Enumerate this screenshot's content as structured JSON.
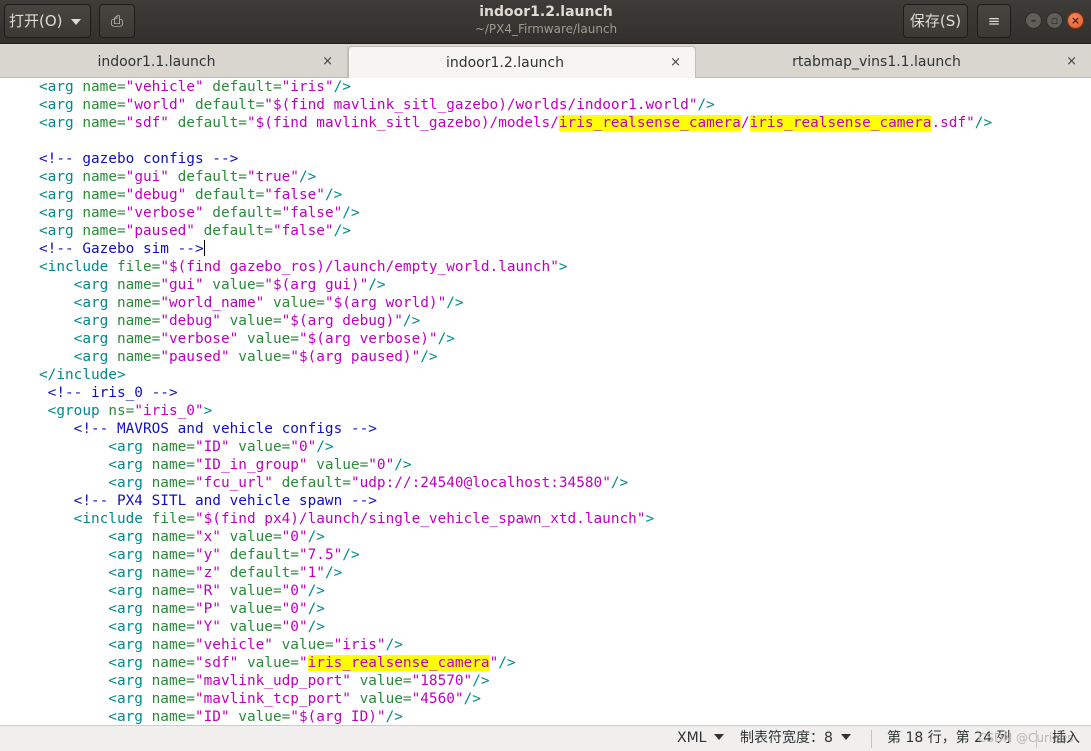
{
  "header": {
    "open_label": "打开(O)",
    "title": "indoor1.2.launch",
    "subtitle": "~/PX4_Firmware/launch",
    "save_label": "保存(S)",
    "menu_glyph": "≡",
    "newtab_glyph": "⎙",
    "min_glyph": "–",
    "max_glyph": "▫",
    "close_glyph": "×"
  },
  "tabs": [
    {
      "label": "indoor1.1.launch",
      "close": "×"
    },
    {
      "label": "indoor1.2.launch",
      "close": "×"
    },
    {
      "label": "rtabmap_vins1.1.launch",
      "close": "×"
    }
  ],
  "editor": {
    "cursor_line": 18,
    "lines": [
      [
        [
          "t",
          "<arg "
        ],
        [
          "a",
          "name="
        ],
        [
          "v",
          "\"vehicle\""
        ],
        [
          "a",
          " default="
        ],
        [
          "v",
          "\"iris\""
        ],
        [
          "t",
          "/>"
        ]
      ],
      [
        [
          "t",
          "<arg "
        ],
        [
          "a",
          "name="
        ],
        [
          "v",
          "\"world\""
        ],
        [
          "a",
          " default="
        ],
        [
          "v",
          "\"$(find mavlink_sitl_gazebo)/worlds/indoor1.world\""
        ],
        [
          "t",
          "/>"
        ]
      ],
      [
        [
          "t",
          "<arg "
        ],
        [
          "a",
          "name="
        ],
        [
          "v",
          "\"sdf\""
        ],
        [
          "a",
          " default="
        ],
        [
          "v",
          "\"$(find mavlink_sitl_gazebo)/models/"
        ],
        [
          "vh",
          "iris_realsense_camera"
        ],
        [
          "v",
          "/"
        ],
        [
          "vh",
          "iris_realsense_camera"
        ],
        [
          "v",
          ".sdf\""
        ],
        [
          "t",
          "/>"
        ]
      ],
      [],
      [
        [
          "c",
          "<!-- gazebo configs -->"
        ]
      ],
      [
        [
          "t",
          "<arg "
        ],
        [
          "a",
          "name="
        ],
        [
          "v",
          "\"gui\""
        ],
        [
          "a",
          " default="
        ],
        [
          "v",
          "\"true\""
        ],
        [
          "t",
          "/>"
        ]
      ],
      [
        [
          "t",
          "<arg "
        ],
        [
          "a",
          "name="
        ],
        [
          "v",
          "\"debug\""
        ],
        [
          "a",
          " default="
        ],
        [
          "v",
          "\"false\""
        ],
        [
          "t",
          "/>"
        ]
      ],
      [
        [
          "t",
          "<arg "
        ],
        [
          "a",
          "name="
        ],
        [
          "v",
          "\"verbose\""
        ],
        [
          "a",
          " default="
        ],
        [
          "v",
          "\"false\""
        ],
        [
          "t",
          "/>"
        ]
      ],
      [
        [
          "t",
          "<arg "
        ],
        [
          "a",
          "name="
        ],
        [
          "v",
          "\"paused\""
        ],
        [
          "a",
          " default="
        ],
        [
          "v",
          "\"false\""
        ],
        [
          "t",
          "/>"
        ]
      ],
      [
        [
          "c",
          "<!-- Gazebo sim -->"
        ],
        [
          "cursor",
          ""
        ]
      ],
      [
        [
          "t",
          "<include "
        ],
        [
          "a",
          "file="
        ],
        [
          "v",
          "\"$(find gazebo_ros)/launch/empty_world.launch\""
        ],
        [
          "t",
          ">"
        ]
      ],
      [
        [
          "t",
          "    <arg "
        ],
        [
          "a",
          "name="
        ],
        [
          "v",
          "\"gui\""
        ],
        [
          "a",
          " value="
        ],
        [
          "v",
          "\"$(arg gui)\""
        ],
        [
          "t",
          "/>"
        ]
      ],
      [
        [
          "t",
          "    <arg "
        ],
        [
          "a",
          "name="
        ],
        [
          "v",
          "\"world_name\""
        ],
        [
          "a",
          " value="
        ],
        [
          "v",
          "\"$(arg world)\""
        ],
        [
          "t",
          "/>"
        ]
      ],
      [
        [
          "t",
          "    <arg "
        ],
        [
          "a",
          "name="
        ],
        [
          "v",
          "\"debug\""
        ],
        [
          "a",
          " value="
        ],
        [
          "v",
          "\"$(arg debug)\""
        ],
        [
          "t",
          "/>"
        ]
      ],
      [
        [
          "t",
          "    <arg "
        ],
        [
          "a",
          "name="
        ],
        [
          "v",
          "\"verbose\""
        ],
        [
          "a",
          " value="
        ],
        [
          "v",
          "\"$(arg verbose)\""
        ],
        [
          "t",
          "/>"
        ]
      ],
      [
        [
          "t",
          "    <arg "
        ],
        [
          "a",
          "name="
        ],
        [
          "v",
          "\"paused\""
        ],
        [
          "a",
          " value="
        ],
        [
          "v",
          "\"$(arg paused)\""
        ],
        [
          "t",
          "/>"
        ]
      ],
      [
        [
          "t",
          "</include>"
        ]
      ],
      [
        [
          "c",
          " <!-- iris_0 -->"
        ]
      ],
      [
        [
          "t",
          " <group "
        ],
        [
          "a",
          "ns="
        ],
        [
          "v",
          "\"iris_0\""
        ],
        [
          "t",
          ">"
        ]
      ],
      [
        [
          "c",
          "    <!-- MAVROS and vehicle configs -->"
        ]
      ],
      [
        [
          "t",
          "        <arg "
        ],
        [
          "a",
          "name="
        ],
        [
          "v",
          "\"ID\""
        ],
        [
          "a",
          " value="
        ],
        [
          "v",
          "\"0\""
        ],
        [
          "t",
          "/>"
        ]
      ],
      [
        [
          "t",
          "        <arg "
        ],
        [
          "a",
          "name="
        ],
        [
          "v",
          "\"ID_in_group\""
        ],
        [
          "a",
          " value="
        ],
        [
          "v",
          "\"0\""
        ],
        [
          "t",
          "/>"
        ]
      ],
      [
        [
          "t",
          "        <arg "
        ],
        [
          "a",
          "name="
        ],
        [
          "v",
          "\"fcu_url\""
        ],
        [
          "a",
          " default="
        ],
        [
          "v",
          "\"udp://:24540@localhost:34580\""
        ],
        [
          "t",
          "/>"
        ]
      ],
      [
        [
          "c",
          "    <!-- PX4 SITL and vehicle spawn -->"
        ]
      ],
      [
        [
          "t",
          "    <include "
        ],
        [
          "a",
          "file="
        ],
        [
          "v",
          "\"$(find px4)/launch/single_vehicle_spawn_xtd.launch\""
        ],
        [
          "t",
          ">"
        ]
      ],
      [
        [
          "t",
          "        <arg "
        ],
        [
          "a",
          "name="
        ],
        [
          "v",
          "\"x\""
        ],
        [
          "a",
          " value="
        ],
        [
          "v",
          "\"0\""
        ],
        [
          "t",
          "/>"
        ]
      ],
      [
        [
          "t",
          "        <arg "
        ],
        [
          "a",
          "name="
        ],
        [
          "v",
          "\"y\""
        ],
        [
          "a",
          " default="
        ],
        [
          "v",
          "\"7.5\""
        ],
        [
          "t",
          "/>"
        ]
      ],
      [
        [
          "t",
          "        <arg "
        ],
        [
          "a",
          "name="
        ],
        [
          "v",
          "\"z\""
        ],
        [
          "a",
          " default="
        ],
        [
          "v",
          "\"1\""
        ],
        [
          "t",
          "/>"
        ]
      ],
      [
        [
          "t",
          "        <arg "
        ],
        [
          "a",
          "name="
        ],
        [
          "v",
          "\"R\""
        ],
        [
          "a",
          " value="
        ],
        [
          "v",
          "\"0\""
        ],
        [
          "t",
          "/>"
        ]
      ],
      [
        [
          "t",
          "        <arg "
        ],
        [
          "a",
          "name="
        ],
        [
          "v",
          "\"P\""
        ],
        [
          "a",
          " value="
        ],
        [
          "v",
          "\"0\""
        ],
        [
          "t",
          "/>"
        ]
      ],
      [
        [
          "t",
          "        <arg "
        ],
        [
          "a",
          "name="
        ],
        [
          "v",
          "\"Y\""
        ],
        [
          "a",
          " value="
        ],
        [
          "v",
          "\"0\""
        ],
        [
          "t",
          "/>"
        ]
      ],
      [
        [
          "t",
          "        <arg "
        ],
        [
          "a",
          "name="
        ],
        [
          "v",
          "\"vehicle\""
        ],
        [
          "a",
          " value="
        ],
        [
          "v",
          "\"iris\""
        ],
        [
          "t",
          "/>"
        ]
      ],
      [
        [
          "t",
          "        <arg "
        ],
        [
          "a",
          "name="
        ],
        [
          "v",
          "\"sdf\""
        ],
        [
          "a",
          " value="
        ],
        [
          "v",
          "\""
        ],
        [
          "vh",
          "iris_realsense_camera"
        ],
        [
          "v",
          "\""
        ],
        [
          "t",
          "/>"
        ]
      ],
      [
        [
          "t",
          "        <arg "
        ],
        [
          "a",
          "name="
        ],
        [
          "v",
          "\"mavlink_udp_port\""
        ],
        [
          "a",
          " value="
        ],
        [
          "v",
          "\"18570\""
        ],
        [
          "t",
          "/>"
        ]
      ],
      [
        [
          "t",
          "        <arg "
        ],
        [
          "a",
          "name="
        ],
        [
          "v",
          "\"mavlink_tcp_port\""
        ],
        [
          "a",
          " value="
        ],
        [
          "v",
          "\"4560\""
        ],
        [
          "t",
          "/>"
        ]
      ],
      [
        [
          "t",
          "        <arg "
        ],
        [
          "a",
          "name="
        ],
        [
          "v",
          "\"ID\""
        ],
        [
          "a",
          " value="
        ],
        [
          "v",
          "\"$(arg ID)\""
        ],
        [
          "t",
          "/>"
        ]
      ]
    ]
  },
  "colors": {
    "tag": "#008a8c",
    "attr": "#2a8a3a",
    "value": "#c000c0",
    "comment": "#1010c0",
    "highlight": "#ffff00"
  },
  "status": {
    "language": "XML",
    "tab_width": "制表符宽度：8",
    "position": "第 18 行，第 24 列",
    "mode": "插入",
    "watermark": "CSDN @Curious"
  }
}
